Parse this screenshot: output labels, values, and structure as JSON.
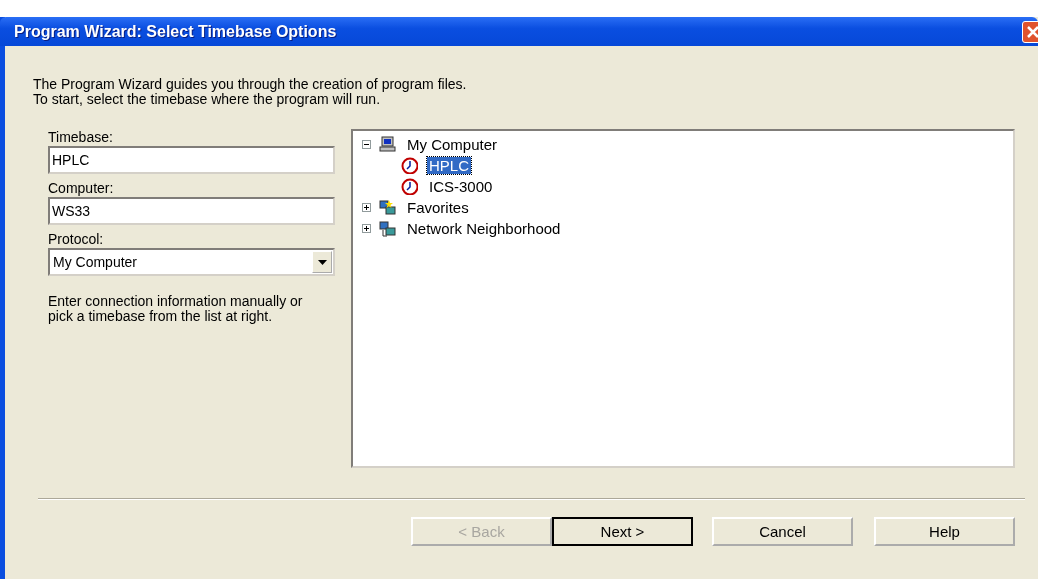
{
  "window": {
    "title": "Program Wizard: Select Timebase Options"
  },
  "intro": [
    "The Program Wizard guides you through the creation of program files.",
    "To start, select the timebase where the program will run."
  ],
  "fields": [
    {
      "label": "Timebase:",
      "value": "HPLC"
    },
    {
      "label": "Computer:",
      "value": "WS33"
    }
  ],
  "protocol": {
    "label": "Protocol:",
    "value": "My Computer"
  },
  "hint": "Enter connection information manually or pick a timebase from the list at right.",
  "tree": [
    {
      "label": "My Computer",
      "kind": "computer",
      "expanded": true,
      "selected": false,
      "children": [
        {
          "label": "HPLC",
          "kind": "timebase",
          "selected": true
        },
        {
          "label": "ICS-3000",
          "kind": "timebase",
          "selected": false
        }
      ]
    },
    {
      "label": "Favorites",
      "kind": "favorites",
      "expanded": false,
      "selected": false
    },
    {
      "label": "Network Neighborhood",
      "kind": "network",
      "expanded": false,
      "selected": false
    }
  ],
  "buttons": [
    {
      "label": "< Back",
      "disabled": true,
      "default": false
    },
    {
      "label": "Next >",
      "disabled": false,
      "default": true
    },
    {
      "label": "Cancel",
      "disabled": false,
      "default": false
    },
    {
      "label": "Help",
      "disabled": false,
      "default": false
    }
  ]
}
